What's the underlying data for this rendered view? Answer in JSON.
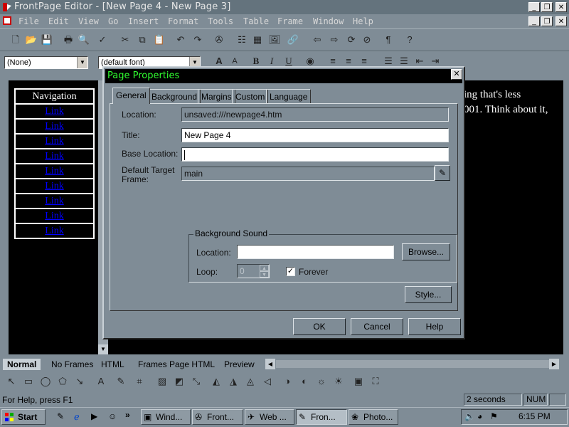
{
  "window": {
    "title": "FrontPage Editor - [New Page 4 - New Page 3]",
    "controls": [
      "_",
      "❐",
      "✕"
    ],
    "doc_controls": [
      "_",
      "❐",
      "✕"
    ]
  },
  "menu": [
    "File",
    "Edit",
    "View",
    "Go",
    "Insert",
    "Format",
    "Tools",
    "Table",
    "Frame",
    "Window",
    "Help"
  ],
  "format_bar": {
    "style_value": "(None)",
    "font_value": "(default font)"
  },
  "document": {
    "nav_header": "Navigation",
    "nav_links": [
      "Link",
      "Link",
      "Link",
      "Link",
      "Link",
      "Link",
      "Link",
      "Link",
      "Link"
    ],
    "text_line1": "ing that's less",
    "text_line2": "001.  Think about it,"
  },
  "view_tabs": [
    "Normal",
    "No Frames",
    "HTML",
    "Frames Page HTML",
    "Preview"
  ],
  "status": {
    "help": "For Help, press F1",
    "time_est": "2 seconds",
    "num": "NUM"
  },
  "taskbar": {
    "start": "Start",
    "buttons": [
      "Wind...",
      "Front...",
      "Web ...",
      "Fron...",
      "Photo..."
    ],
    "clock": "6:15 PM"
  },
  "dialog": {
    "title": "Page Properties",
    "tabs": [
      "General",
      "Background",
      "Margins",
      "Custom",
      "Language"
    ],
    "location_label": "Location:",
    "location_value": "unsaved:///newpage4.htm",
    "title_label": "Title:",
    "title_value": "New Page 4",
    "base_location_label": "Base Location:",
    "base_location_value": "",
    "target_frame_label": "Default Target Frame:",
    "target_frame_value": "main",
    "sound_group": "Background Sound",
    "sound_location_label": "Location:",
    "sound_location_value": "",
    "browse_label": "Browse...",
    "loop_label": "Loop:",
    "loop_value": "0",
    "forever_label": "Forever",
    "forever_checked": true,
    "style_label": "Style...",
    "ok_label": "OK",
    "cancel_label": "Cancel",
    "help_label": "Help"
  }
}
